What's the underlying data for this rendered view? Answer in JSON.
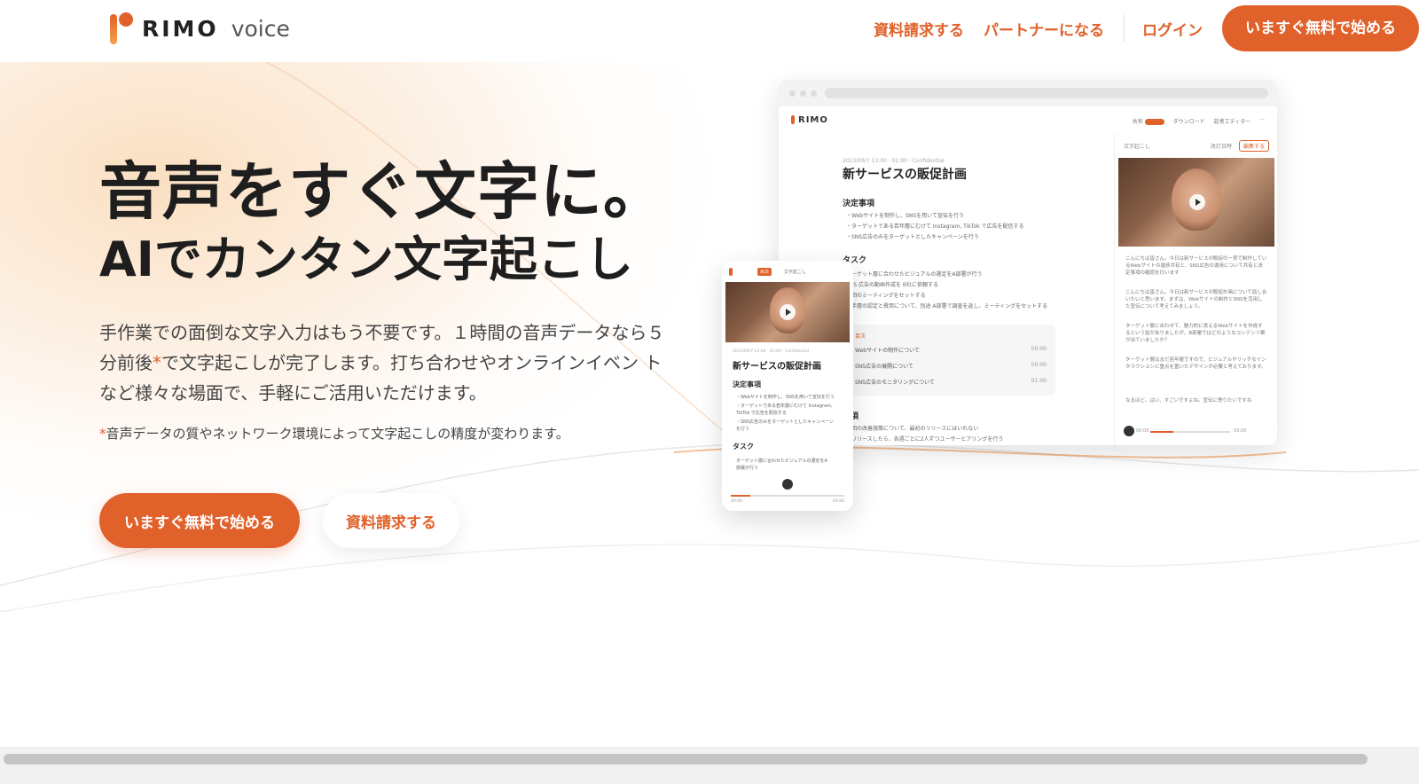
{
  "header": {
    "logo_text": "RIMO",
    "logo_sub": "voice",
    "nav": {
      "docs": "資料請求する",
      "partner": "パートナーになる",
      "login": "ログイン",
      "cta": "いますぐ無料で始める"
    }
  },
  "hero": {
    "title_line1": "音声をすぐ文字に。",
    "title_line2": "AIでカンタン文字起こし",
    "desc_part1": "手作業での面倒な文字入力はもう不要です。１時間の音声データなら５分前後",
    "desc_asterisk": "*",
    "desc_part2": "で文字起こしが完了します。打ち合わせやオンラインイベン トなど様々な場面で、手軽にご活用いただけます。",
    "note_asterisk": "*",
    "note_text": "音声データの質やネットワーク環境によって文字起こしの精度が変わります。",
    "primary_button": "いますぐ無料で始める",
    "secondary_button": "資料請求する"
  },
  "desktop_mock": {
    "logo": "RIMO",
    "toolbar": [
      "共有",
      "ダウンロード",
      "話者エディター",
      "···"
    ],
    "meta": "2023/09/7 13:00  ·  01:00  ·  Confidential",
    "title": "新サービスの販促計画",
    "sections": {
      "decisions": "決定事項",
      "tasks": "タスク",
      "items": "事項"
    },
    "decisions": [
      "・Webサイトを制作し、SNSを用いて宣伝を行う",
      "・ターゲットである若年層にむけて Instagram, TikTok で広告を配信する",
      "・SNS広告のみをターゲットとしたキャンペーンを行う"
    ],
    "tasks": [
      "ターゲット層に合わせたビジュアルの選定をA部署が行う",
      "SNS 広告の動画作成を B社に依頼する",
      "次回のミーティングをセットする",
      "若手層の認定と費用について、別途 A部署で調査を返し、ミーティングをセットする"
    ],
    "table_label": "目次",
    "table_rows": [
      {
        "label": "Webサイトの制作について",
        "time": "00:00"
      },
      {
        "label": "SNS広告の展開について",
        "time": "00:00"
      },
      {
        "label": "SNS広告のモニタリングについて",
        "time": "01:00"
      }
    ],
    "items": [
      "次回の改善施策について、最初のリリースにはいれない",
      "新リリースしたら、各週ごとに2人ずつユーザーヒアリングを行う"
    ],
    "side_head": "文字起こし",
    "side_mode": "改訂日時",
    "side_button": "編集する",
    "transcript": [
      "こんにちは皆さん。今日は新サービスの販促の一貫で制作しているWebサイトの進捗共有と、SNS広告の運用について共有と決定事項の確認を行います",
      "こんにちは皆さん。今日は新サービスの販促計画について話し合いたいと思います。まずは、Webサイトの制作とSNSを活用した宣伝について考えてみましょう。",
      "ターゲット層に合わせて、魅力的に見えるWebサイトを作成するという話がありましたが、B部署ではどのようなコンテンツ案が出ていましたか？",
      "ターゲット層はまだ若年層ですので、ビジュアルやリッチなインタラクションに重点を置いたデザインが必要と考えております。",
      "なるほど。はい、すごいですよね。宣伝に寄りたいですね"
    ],
    "player_time_start": "00:00",
    "player_time_end": "03:00"
  },
  "mobile_mock": {
    "tab_active": "目次",
    "tab_other": "文字起こし",
    "meta": "2023/09/7 13:00  ·  01:00  ·  Confidential",
    "title": "新サービスの販促計画",
    "decisions_title": "決定事項",
    "decisions": [
      "・Webサイトを制作し、SNSを用いて宣伝を行う",
      "・ターゲットである若年層にむけて Instagram,",
      "  TikTok で広告を配信する",
      "・SNS広告のみをターゲットとしたキャンペーン",
      "  を行う"
    ],
    "tasks_title": "タスク",
    "tasks": [
      "ターゲット層に合わせたビジュアルの選定をA",
      "部署が行う"
    ],
    "time_start": "00:00",
    "time_end": "03:00"
  },
  "colors": {
    "accent": "#e0612a",
    "text": "#1e1e1e",
    "scrollbar_thumb": "#c4c4c4"
  }
}
